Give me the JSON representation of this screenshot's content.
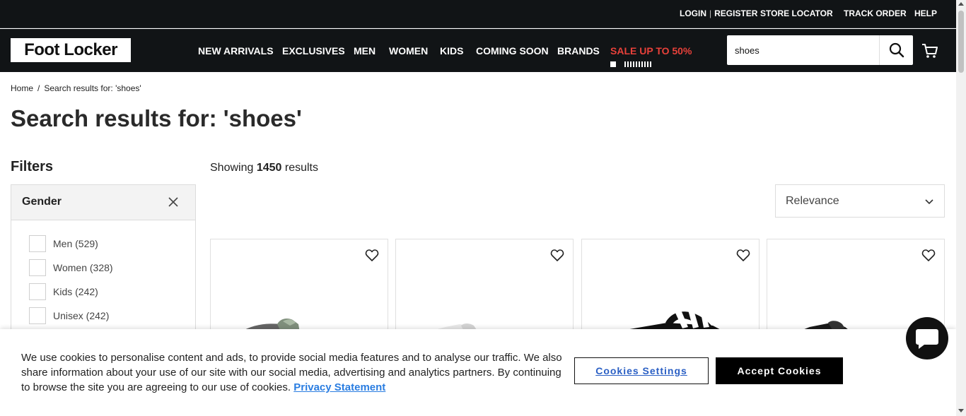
{
  "utility_bar": {
    "login": "LOGIN",
    "register": "REGISTER",
    "login_separator": "|",
    "store_locator": "STORE LOCATOR",
    "track_order": "TRACK ORDER",
    "help": "HELP"
  },
  "header": {
    "logo_text": "Foot Locker",
    "nav": [
      {
        "label": "NEW ARRIVALS"
      },
      {
        "label": "EXCLUSIVES"
      },
      {
        "label": "MEN"
      },
      {
        "label": "WOMEN"
      },
      {
        "label": "KIDS"
      },
      {
        "label": "COMING SOON"
      },
      {
        "label": "BRANDS"
      },
      {
        "label": "SALE UP TO 50%"
      }
    ],
    "sale_color": "#e8413a",
    "search": {
      "value": "shoes",
      "icon": "search-icon"
    },
    "cart_icon": "cart-icon"
  },
  "breadcrumb": {
    "home": "Home",
    "separator": "/",
    "current": "Search results for: 'shoes'"
  },
  "page_title": "Search results for: 'shoes'",
  "filters": {
    "title": "Filters",
    "group_label": "Gender",
    "options": [
      {
        "label": "Men (529)"
      },
      {
        "label": "Women (328)"
      },
      {
        "label": "Kids (242)"
      },
      {
        "label": "Unisex (242)"
      }
    ]
  },
  "results": {
    "prefix": "Showing",
    "count": "1450",
    "suffix": "results"
  },
  "sort": {
    "selected": "Relevance"
  },
  "products": [
    {
      "image": "green-camo-sneaker"
    },
    {
      "image": "white-sneaker"
    },
    {
      "image": "black-white-stripe-slide"
    },
    {
      "image": "black-sneaker"
    }
  ],
  "cookie_banner": {
    "text": "We use cookies to personalise content and ads, to provide social media features and to analyse our traffic. We also share information about your use of our site with our social media, advertising and analytics partners. By continuing to browse the site you are agreeing to our use of cookies.",
    "privacy_link": "Privacy Statement",
    "settings_button": "Cookies Settings",
    "accept_button": "Accept Cookies"
  },
  "colors": {
    "header_bg": "#111416",
    "link_blue": "#2a7de1"
  }
}
